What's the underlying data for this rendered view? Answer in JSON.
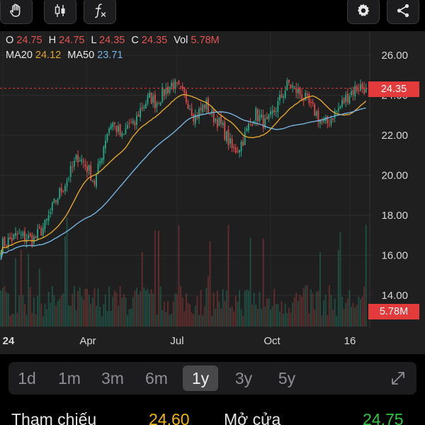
{
  "toolbar": {
    "left_buttons": [
      "hand-icon",
      "candlestick-icon",
      "function-icon"
    ],
    "right_buttons": [
      "gear-icon",
      "share-icon"
    ]
  },
  "legend": {
    "o_label": "O",
    "o_value": "24.75",
    "h_label": "H",
    "h_value": "24.75",
    "l_label": "L",
    "l_value": "24.35",
    "c_label": "C",
    "c_value": "24.35",
    "vol_label": "Vol",
    "vol_value": "5.78M",
    "ma20_label": "MA20",
    "ma20_value": "24.12",
    "ma50_label": "MA50",
    "ma50_value": "23.71"
  },
  "price_axis": [
    "26.00",
    "24.00",
    "22.00",
    "20.00",
    "18.00",
    "16.00",
    "14.00"
  ],
  "time_axis": [
    "24",
    "Apr",
    "Jul",
    "Oct",
    "16"
  ],
  "last_price_tag": "24.35",
  "volume_tag": "5.78M",
  "ranges": [
    "1d",
    "1m",
    "3m",
    "6m",
    "1y",
    "3y",
    "5y"
  ],
  "active_range": "1y",
  "quote": {
    "ref_label": "Tham chiếu",
    "ref_value": "24.60",
    "open_label": "Mở cửa",
    "open_value": "24.75"
  },
  "colors": {
    "up": "#22a887",
    "down": "#e04848",
    "ma20": "#e0a530",
    "ma50": "#75b3e0",
    "tag": "#e33b3b",
    "ref_value": "#f0b800",
    "open_value": "#28c840"
  },
  "chart_data": {
    "type": "candlestick",
    "ylim": [
      13.5,
      26.5
    ],
    "last_price": 24.35,
    "close_path": [
      [
        0,
        16.5
      ],
      [
        3,
        17.0
      ],
      [
        6,
        16.8
      ],
      [
        8,
        17.5
      ],
      [
        10,
        18.8
      ],
      [
        12,
        19.8
      ],
      [
        14,
        21.0
      ],
      [
        16,
        20.2
      ],
      [
        17,
        19.6
      ],
      [
        18,
        20.8
      ],
      [
        19,
        22.0
      ],
      [
        20,
        22.7
      ],
      [
        21,
        22.3
      ],
      [
        22,
        21.8
      ],
      [
        23,
        22.6
      ],
      [
        24,
        22.4
      ],
      [
        25,
        23.2
      ],
      [
        26,
        23.6
      ],
      [
        27,
        23.9
      ],
      [
        28,
        23.6
      ],
      [
        29,
        24.0
      ],
      [
        30,
        24.3
      ],
      [
        31,
        24.6
      ],
      [
        32,
        24.3
      ],
      [
        33,
        24.0
      ],
      [
        34,
        23.6
      ],
      [
        35,
        22.9
      ],
      [
        36,
        23.2
      ],
      [
        37,
        23.6
      ],
      [
        38,
        23.0
      ],
      [
        39,
        22.8
      ],
      [
        40,
        22.4
      ],
      [
        41,
        21.8
      ],
      [
        42,
        21.2
      ],
      [
        43,
        21.4
      ],
      [
        44,
        21.9
      ],
      [
        45,
        22.6
      ],
      [
        46,
        23.1
      ],
      [
        47,
        22.8
      ],
      [
        48,
        22.5
      ],
      [
        49,
        23.0
      ],
      [
        50,
        23.5
      ],
      [
        51,
        24.1
      ],
      [
        52,
        24.6
      ],
      [
        53,
        24.3
      ],
      [
        54,
        24.1
      ],
      [
        55,
        23.8
      ],
      [
        56,
        23.4
      ],
      [
        57,
        23.1
      ],
      [
        58,
        22.6
      ],
      [
        59,
        22.6
      ],
      [
        60,
        23.0
      ],
      [
        61,
        23.3
      ],
      [
        62,
        23.7
      ],
      [
        63,
        24.1
      ],
      [
        64,
        24.3
      ],
      [
        65,
        24.45
      ],
      [
        66,
        24.35
      ]
    ]
  }
}
